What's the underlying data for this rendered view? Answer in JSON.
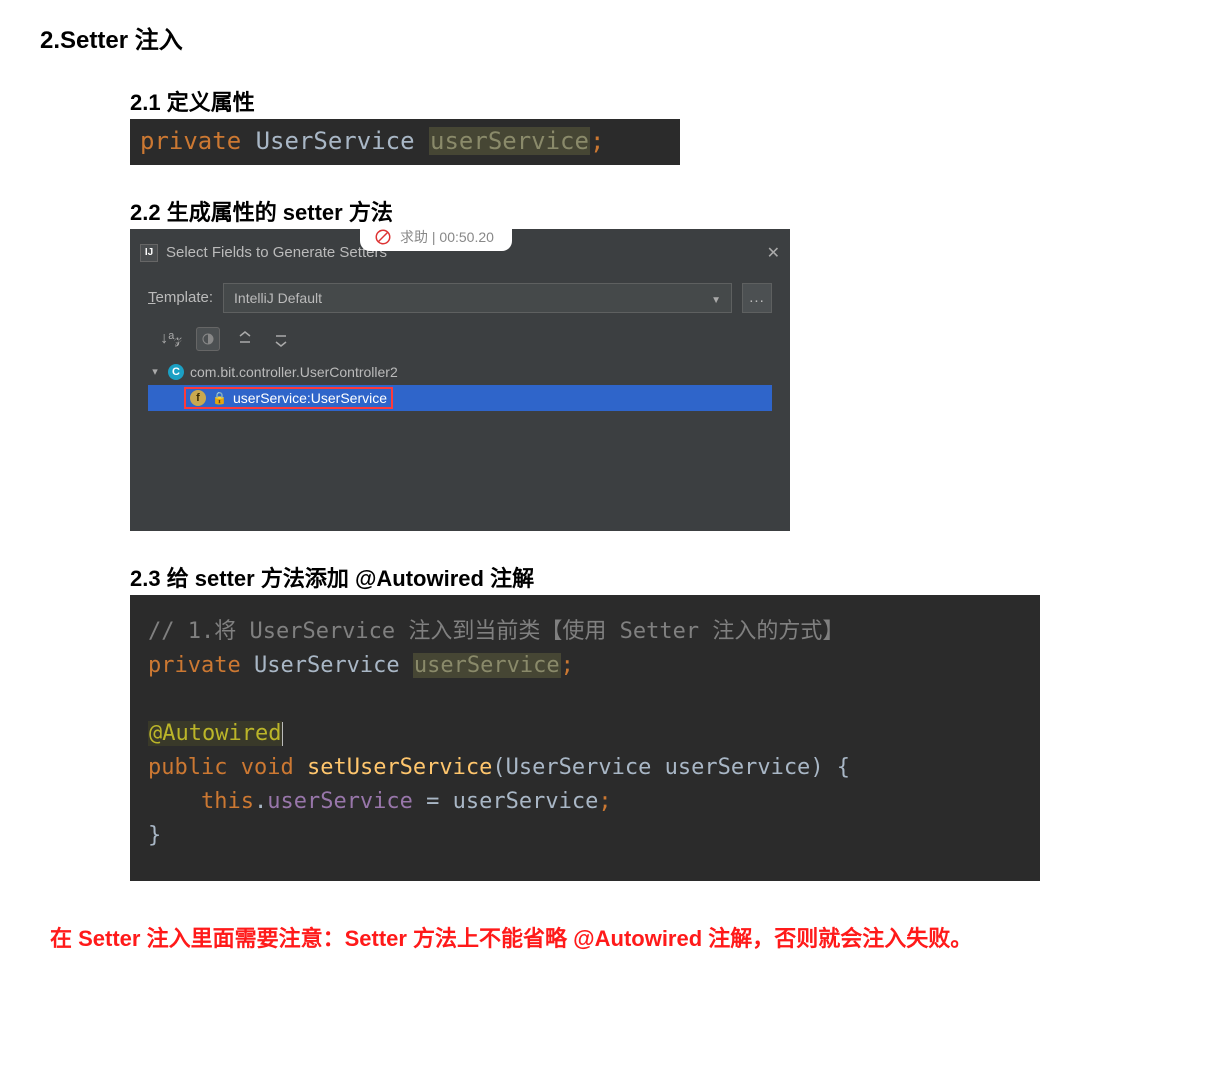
{
  "heading_main": "2.Setter 注入",
  "section_21": {
    "title": "2.1 定义属性",
    "code_private": "private",
    "code_type": "UserService",
    "code_var": "userService",
    "code_end": ";"
  },
  "section_22": {
    "title": "2.2 生成属性的 setter 方法",
    "popup_text": "求助 | 00:50.20",
    "dialog_title": "Select Fields to Generate Setters",
    "template_label": "Template:",
    "template_value": "IntelliJ Default",
    "ellipsis": "...",
    "sort_icon_text": "↓ᵃ𝓏",
    "tree_class": "com.bit.controller.UserController2",
    "tree_field": "userService:UserService"
  },
  "section_23": {
    "title": "2.3 给 setter 方法添加 @Autowired 注解",
    "line1_cmt": "// 1.将 UserService 注入到当前类【使用 Setter 注入的方式】",
    "line2_private": "private",
    "line2_type": "UserService",
    "line2_var": "userService",
    "line2_end": ";",
    "anno": "@Autowired",
    "pub": "public",
    "void": "void",
    "method": "setUserService",
    "paramType": "UserService",
    "paramName": "userService",
    "thiskw": "this",
    "prop": "userService",
    "eq_rhs": "userService",
    "semicolon": ";"
  },
  "footer": "在 Setter 注入里面需要注意：Setter 方法上不能省略 @Autowired 注解，否则就会注入失败。"
}
